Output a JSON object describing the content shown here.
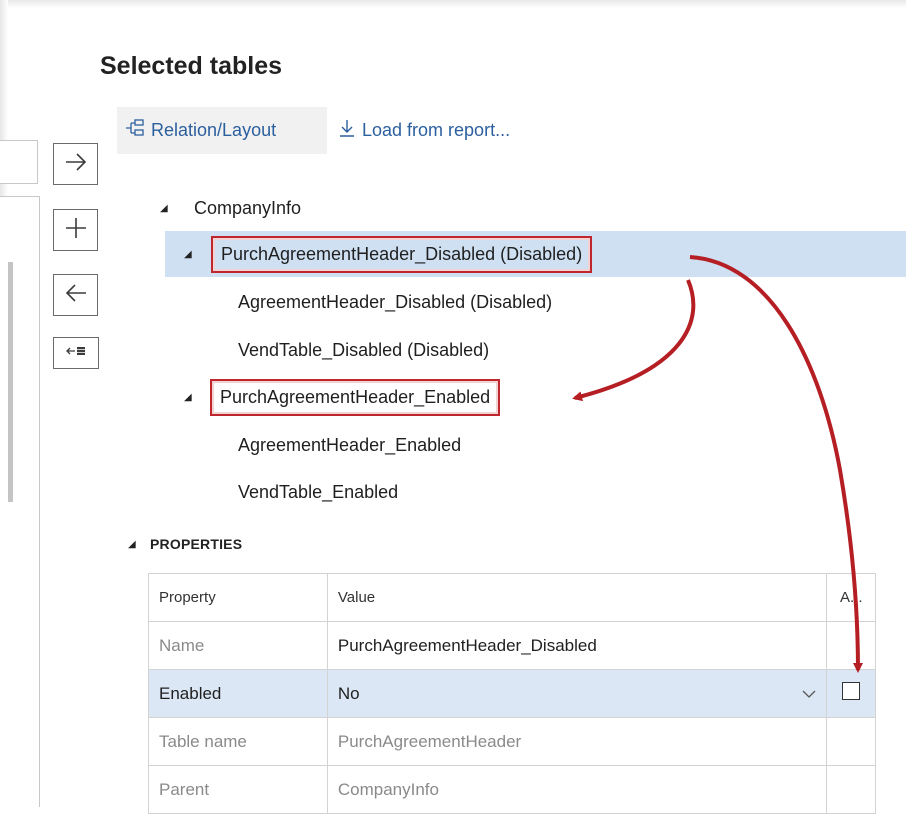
{
  "header": {
    "title": "Selected tables"
  },
  "toolbar": {
    "relation_label": "Relation/Layout",
    "load_label": "Load from report..."
  },
  "side_buttons": [
    "arrow-right-icon",
    "plus-icon",
    "arrow-left-icon",
    "remove-all-icon"
  ],
  "tree": {
    "root": "CompanyInfo",
    "disabled_node": "PurchAgreementHeader_Disabled (Disabled)",
    "disabled_children": [
      "AgreementHeader_Disabled (Disabled)",
      "VendTable_Disabled (Disabled)"
    ],
    "enabled_node": "PurchAgreementHeader_Enabled",
    "enabled_children": [
      "AgreementHeader_Enabled",
      "VendTable_Enabled"
    ]
  },
  "properties": {
    "section_title": "PROPERTIES",
    "columns": [
      "Property",
      "Value",
      "A..."
    ],
    "rows": [
      {
        "property": "Name",
        "value": "PurchAgreementHeader_Disabled"
      },
      {
        "property": "Enabled",
        "value": "No",
        "checked": false
      },
      {
        "property": "Table name",
        "value": "PurchAgreementHeader"
      },
      {
        "property": "Parent",
        "value": "CompanyInfo"
      }
    ]
  },
  "colors": {
    "accent": "#2c5f9e",
    "selection": "#cfe0f2",
    "highlight_border": "#c0262d",
    "arrow": "#b51f24"
  }
}
